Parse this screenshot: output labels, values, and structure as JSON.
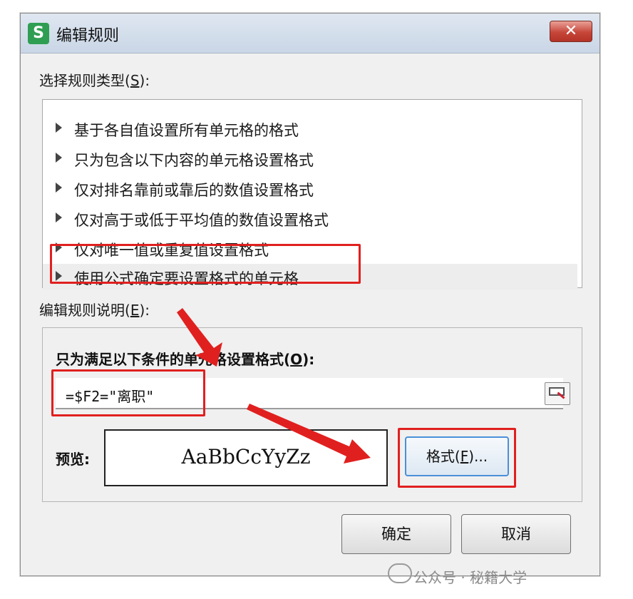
{
  "window": {
    "title": "编辑规则",
    "app_icon_letter": "S",
    "close_label": "✕"
  },
  "rule_type": {
    "label_prefix": "选择规则类型(",
    "label_key": "S",
    "label_suffix": "):",
    "items": [
      {
        "label": "基于各自值设置所有单元格的格式"
      },
      {
        "label": "只为包含以下内容的单元格设置格式"
      },
      {
        "label": "仅对排名靠前或靠后的数值设置格式"
      },
      {
        "label": "仅对高于或低于平均值的数值设置格式"
      },
      {
        "label": "仅对唯一值或重复值设置格式"
      },
      {
        "label": "使用公式确定要设置格式的单元格",
        "selected": true
      }
    ]
  },
  "description": {
    "label_prefix": "编辑规则说明(",
    "label_key": "E",
    "label_suffix": "):",
    "condition_label_prefix": "只为满足以下条件的单元格设置格式(",
    "condition_label_key": "O",
    "condition_label_suffix": "):",
    "formula": "=$F2=\"离职\"",
    "preview_label": "预览:",
    "preview_text": "AaBbCcYyZz",
    "format_button_prefix": "格式(",
    "format_button_key": "F",
    "format_button_suffix": ")..."
  },
  "buttons": {
    "ok": "确定",
    "cancel": "取消"
  },
  "watermark": "公众号 · 秘籍大学",
  "colors": {
    "highlight": "#e0201f",
    "focus_border": "#4a90d8",
    "app_icon": "#2f9e52"
  }
}
